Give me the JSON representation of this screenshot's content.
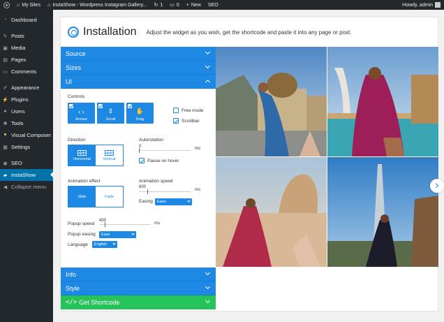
{
  "adminbar": {
    "my_sites": "My Sites",
    "site_name": "InstaShow - Wordpress Instagram Gallery...",
    "updates_count": "1",
    "comments_count": "0",
    "new_label": "New",
    "seo_label": "SEO",
    "howdy": "Howdy, admin"
  },
  "sidebar": {
    "items": [
      {
        "label": "Dashboard",
        "icon": "dashboard-icon"
      },
      {
        "label": "Posts",
        "icon": "pin-icon"
      },
      {
        "label": "Media",
        "icon": "media-icon"
      },
      {
        "label": "Pages",
        "icon": "page-icon"
      },
      {
        "label": "Comments",
        "icon": "comment-icon"
      },
      {
        "label": "Appearance",
        "icon": "brush-icon"
      },
      {
        "label": "Plugins",
        "icon": "plugin-icon"
      },
      {
        "label": "Users",
        "icon": "user-icon"
      },
      {
        "label": "Tools",
        "icon": "wrench-icon"
      },
      {
        "label": "Visual Composer",
        "icon": "vc-icon"
      },
      {
        "label": "Settings",
        "icon": "settings-icon"
      },
      {
        "label": "SEO",
        "icon": "seo-icon"
      },
      {
        "label": "InstaShow",
        "icon": "instashow-icon"
      },
      {
        "label": "Collapse menu",
        "icon": "collapse-icon"
      }
    ]
  },
  "header": {
    "title": "Installation",
    "description": "Adjust the widget as you wish, get the shortcode and paste it into any page or post."
  },
  "accordion": {
    "source": "Source",
    "sizes": "Sizes",
    "ui": "UI",
    "info": "Info",
    "style": "Style",
    "shortcode": "Get Shortcode"
  },
  "ui": {
    "controls_label": "Controls",
    "controls": {
      "arrows": "Arrows",
      "scroll": "Scroll",
      "drag": "Drag"
    },
    "free_mode": "Free mode",
    "scrollbar": "Scrollbar",
    "direction_label": "Direction",
    "direction": {
      "horizontal": "Horizontal",
      "vertical": "Vertical"
    },
    "autorotation_label": "Autorotation",
    "autorotation_value": "0",
    "autorotation_unit": "ms",
    "pause_on_hover": "Pause on hover",
    "animation_effect_label": "Animation effect",
    "effect": {
      "slide": "Slide",
      "fade": "Fade"
    },
    "animation_speed_label": "Animation speed",
    "animation_speed_value": "600",
    "animation_speed_unit": "ms",
    "easing_label": "Easing",
    "easing_value": "Ease",
    "popup_speed_label": "Popup speed",
    "popup_speed_value": "400",
    "popup_speed_unit": "ms",
    "popup_easing_label": "Popup easing",
    "popup_easing_value": "Ease",
    "language_label": "Language",
    "language_value": "English"
  },
  "colors": {
    "accent": "#1e88e5",
    "green": "#26c35a",
    "admin_bg": "#23282d",
    "active_menu": "#0073aa"
  }
}
